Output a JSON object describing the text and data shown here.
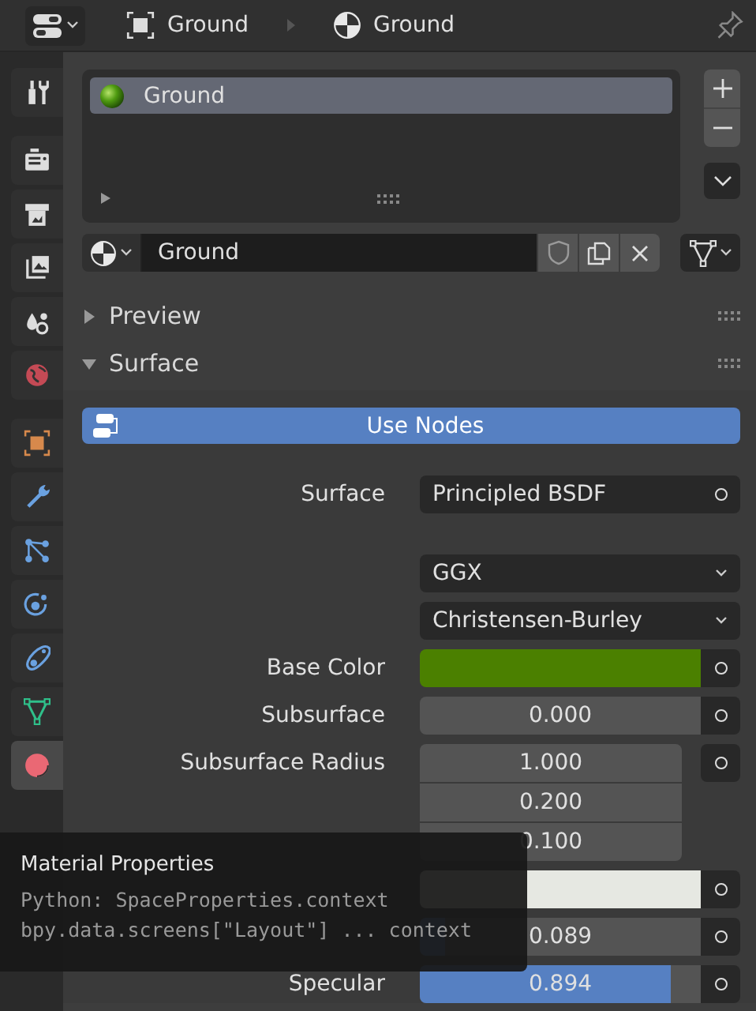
{
  "header": {
    "object_name": "Ground",
    "material_name": "Ground"
  },
  "tab_groups": [
    [
      {
        "kind": "tool",
        "selected": false
      }
    ],
    [
      {
        "kind": "render",
        "selected": false
      },
      {
        "kind": "output",
        "selected": false
      },
      {
        "kind": "view_layer",
        "selected": false
      },
      {
        "kind": "scene",
        "selected": false
      },
      {
        "kind": "world",
        "selected": false
      }
    ],
    [
      {
        "kind": "object",
        "selected": false
      },
      {
        "kind": "modifiers",
        "selected": false
      },
      {
        "kind": "particles",
        "selected": false
      },
      {
        "kind": "physics",
        "selected": false
      },
      {
        "kind": "constraints",
        "selected": false
      },
      {
        "kind": "data",
        "selected": false
      },
      {
        "kind": "material",
        "selected": true
      }
    ]
  ],
  "slots": [
    {
      "name": "Ground",
      "selected": true
    }
  ],
  "datablock": {
    "name": "Ground"
  },
  "panels": [
    {
      "title": "Preview",
      "expanded": false
    },
    {
      "title": "Surface",
      "expanded": true
    }
  ],
  "use_nodes": {
    "label": "Use Nodes"
  },
  "properties": [
    {
      "kind": "link",
      "label": "Surface",
      "value": "Principled BSDF"
    },
    {
      "kind": "dropdown",
      "value": "GGX"
    },
    {
      "kind": "dropdown",
      "value": "Christensen-Burley"
    },
    {
      "kind": "color",
      "label": "Base Color",
      "color": "#4b8000"
    },
    {
      "kind": "slider",
      "label": "Subsurface",
      "value": "0.000",
      "level": 0
    },
    {
      "kind": "vector",
      "label": "Subsurface Radius",
      "values": [
        "1.000",
        "0.200",
        "0.100"
      ]
    },
    {
      "kind": "color",
      "color": "#e6e8e2"
    },
    {
      "kind": "slider",
      "value": "0.089",
      "level": 0.089
    },
    {
      "kind": "slider",
      "label": "Specular",
      "value": "0.894",
      "level": 0.894
    }
  ],
  "tooltip": {
    "title": "Material Properties",
    "lines": [
      "Python: SpaceProperties.context",
      "bpy.data.screens[\"Layout\"] ... context"
    ]
  }
}
